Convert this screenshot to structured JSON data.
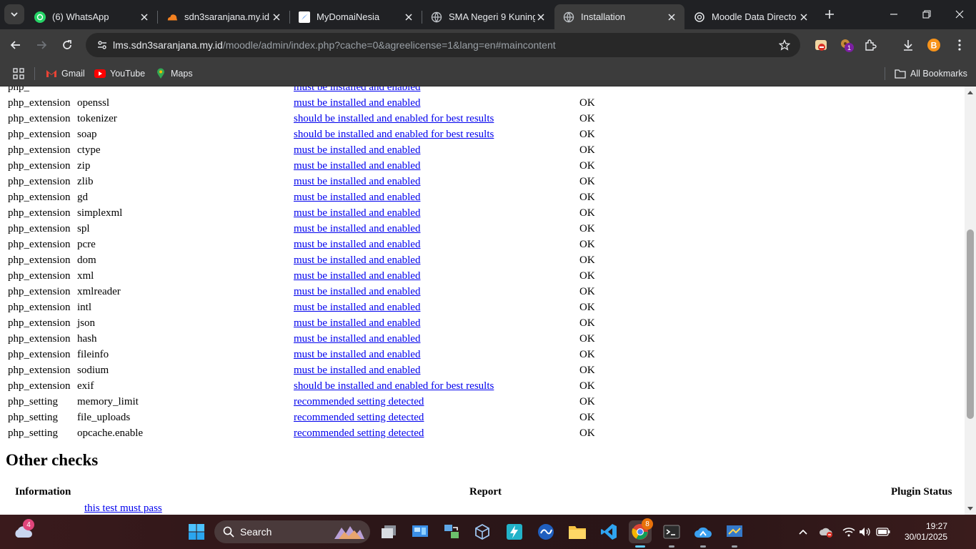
{
  "browser": {
    "tabs": [
      {
        "title": "(6) WhatsApp",
        "icon": "whatsapp-icon"
      },
      {
        "title": "sdn3saranjana.my.id |",
        "icon": "cloudflare-icon"
      },
      {
        "title": "MyDomaiNesia",
        "icon": "domainesia-icon"
      },
      {
        "title": "SMA Negeri 9 Kuning",
        "icon": "globe-icon"
      },
      {
        "title": "Installation",
        "icon": "globe-icon"
      },
      {
        "title": "Moodle Data Directo",
        "icon": "chatgpt-icon"
      }
    ],
    "active_tab": 4,
    "url_host": "lms.sdn3saranjana.my.id",
    "url_path": "/moodle/admin/index.php?cache=0&agreelicense=1&lang=en#maincontent",
    "extension_badge": "1",
    "bookmarks": [
      "Gmail",
      "YouTube",
      "Maps"
    ],
    "all_bookmarks": "All Bookmarks"
  },
  "environment": {
    "rows": [
      {
        "type": "php_",
        "name": "",
        "report": "must be installed and enabled",
        "status": ""
      },
      {
        "type": "php_extension",
        "name": "openssl",
        "report": "must be installed and enabled",
        "status": "OK"
      },
      {
        "type": "php_extension",
        "name": "tokenizer",
        "report": "should be installed and enabled for best results",
        "status": "OK"
      },
      {
        "type": "php_extension",
        "name": "soap",
        "report": "should be installed and enabled for best results",
        "status": "OK"
      },
      {
        "type": "php_extension",
        "name": "ctype",
        "report": "must be installed and enabled",
        "status": "OK"
      },
      {
        "type": "php_extension",
        "name": "zip",
        "report": "must be installed and enabled",
        "status": "OK"
      },
      {
        "type": "php_extension",
        "name": "zlib",
        "report": "must be installed and enabled",
        "status": "OK"
      },
      {
        "type": "php_extension",
        "name": "gd",
        "report": "must be installed and enabled",
        "status": "OK"
      },
      {
        "type": "php_extension",
        "name": "simplexml",
        "report": "must be installed and enabled",
        "status": "OK"
      },
      {
        "type": "php_extension",
        "name": "spl",
        "report": "must be installed and enabled",
        "status": "OK"
      },
      {
        "type": "php_extension",
        "name": "pcre",
        "report": "must be installed and enabled",
        "status": "OK"
      },
      {
        "type": "php_extension",
        "name": "dom",
        "report": "must be installed and enabled",
        "status": "OK"
      },
      {
        "type": "php_extension",
        "name": "xml",
        "report": "must be installed and enabled",
        "status": "OK"
      },
      {
        "type": "php_extension",
        "name": "xmlreader",
        "report": "must be installed and enabled",
        "status": "OK"
      },
      {
        "type": "php_extension",
        "name": "intl",
        "report": "must be installed and enabled",
        "status": "OK"
      },
      {
        "type": "php_extension",
        "name": "json",
        "report": "must be installed and enabled",
        "status": "OK"
      },
      {
        "type": "php_extension",
        "name": "hash",
        "report": "must be installed and enabled",
        "status": "OK"
      },
      {
        "type": "php_extension",
        "name": "fileinfo",
        "report": "must be installed and enabled",
        "status": "OK"
      },
      {
        "type": "php_extension",
        "name": "sodium",
        "report": "must be installed and enabled",
        "status": "OK"
      },
      {
        "type": "php_extension",
        "name": "exif",
        "report": "should be installed and enabled for best results",
        "status": "OK"
      },
      {
        "type": "php_setting",
        "name": "memory_limit",
        "report": "recommended setting detected",
        "status": "OK"
      },
      {
        "type": "php_setting",
        "name": "file_uploads",
        "report": "recommended setting detected",
        "status": "OK"
      },
      {
        "type": "php_setting",
        "name": "opcache.enable",
        "report": "recommended setting detected",
        "status": "OK"
      }
    ]
  },
  "other_checks": {
    "title": "Other checks",
    "headers": {
      "information": "Information",
      "report": "Report",
      "plugin_status": "Plugin Status"
    },
    "first_row_link": "this test must pass"
  },
  "taskbar": {
    "weather_badge": "4",
    "search_label": "Search",
    "chrome_badge": "8",
    "time": "19:27",
    "date": "30/01/2025"
  },
  "colors": {
    "link": "#0000ee",
    "browser_frame": "#202124",
    "toolbar": "#3c3c3c"
  }
}
